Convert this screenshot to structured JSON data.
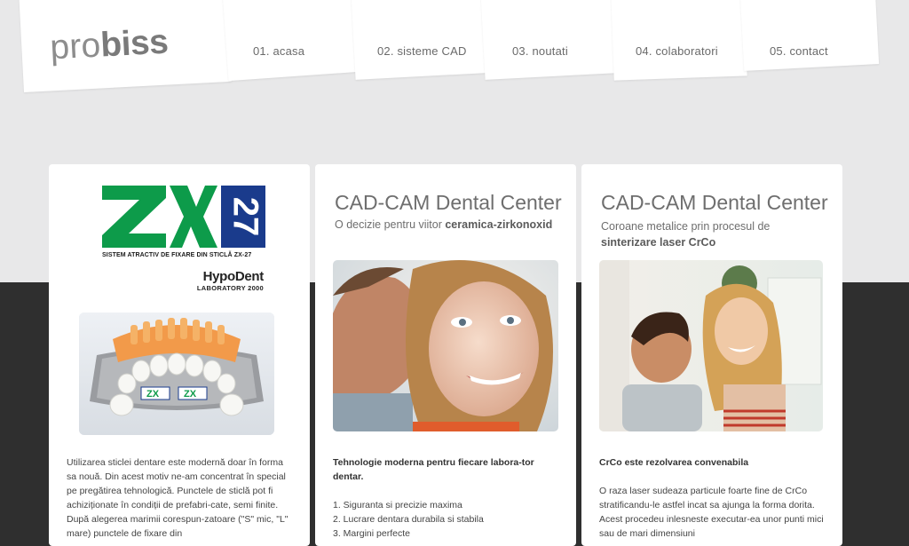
{
  "header": {
    "logo_light": "pro",
    "logo_bold": "biss",
    "nav": [
      {
        "label": "01. acasa"
      },
      {
        "label": "02. sisteme CAD"
      },
      {
        "label": "03. noutati"
      },
      {
        "label": "04. colaboratori"
      },
      {
        "label": "05. contact"
      }
    ]
  },
  "card1": {
    "zx_tagline": "SISTEM ATRACTIV DE FIXARE DIN STICLĂ ZX-27",
    "zx_mark": "ZX",
    "zx_number": "27",
    "brand": "HypoDent",
    "brand_sub": "LABORATORY 2000",
    "badge_text": "ZX",
    "text": "Utilizarea sticlei dentare este modernă doar în forma sa nouă. Din acest motiv ne-am concentrat în special pe pregătirea tehnologică. Punctele de sticlă pot fi achiziționate în condiții de prefabri-cate, semi finite. După alegerea marimii corespun-zatoare (\"S\" mic, \"L\" mare) punctele de fixare din"
  },
  "card2": {
    "title": "CAD-CAM Dental Center",
    "subtitle_normal": "O decizie pentru viitor ",
    "subtitle_bold": "ceramica-zirkonoxid",
    "heading": "Tehnologie moderna pentru fiecare labora-tor dentar.",
    "list": [
      "1. Siguranta si precizie maxima",
      "2. Lucrare dentara durabila si stabila",
      "3. Margini perfecte"
    ]
  },
  "card3": {
    "title": "CAD-CAM Dental Center",
    "subtitle_line1": "Coroane metalice prin procesul de",
    "subtitle_bold": "sinterizare laser CrCo",
    "heading": "CrCo este rezolvarea convenabila",
    "text": "O raza laser sudeaza particule foarte fine de CrCo stratificandu-le astfel incat sa ajunga la forma dorita. Acest procedeu inlesneste executar-ea unor punti mici sau de mari dimensiuni"
  },
  "colors": {
    "zx_green": "#0d9b4a",
    "zx_blue": "#1a3b8c",
    "band": "#e8e8e9",
    "dark": "#2f2f2f"
  }
}
